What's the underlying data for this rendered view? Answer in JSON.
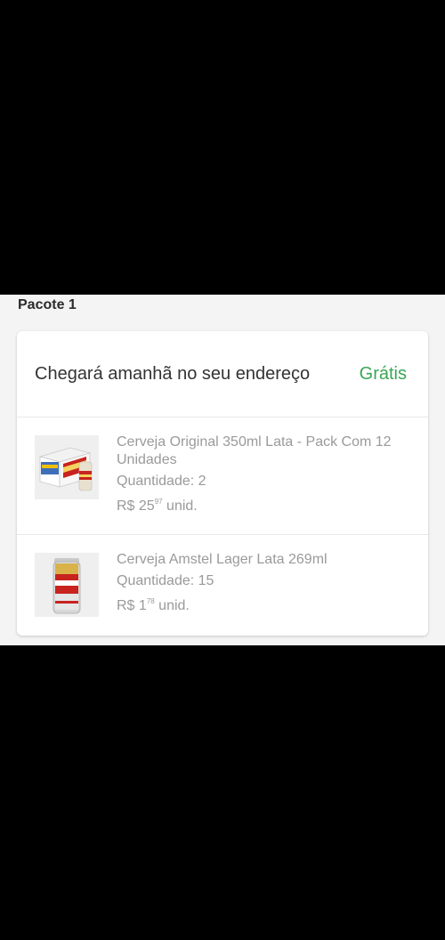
{
  "package": {
    "title": "Pacote 1"
  },
  "delivery": {
    "text": "Chegará amanhã no seu endereço",
    "shipping": "Grátis"
  },
  "items": [
    {
      "name": "Cerveja Original 350ml Lata - Pack Com 12 Unidades",
      "quantity": "Quantidade: 2",
      "currency": "R$ ",
      "price_int": "25",
      "price_cents": "97",
      "unit": " unid."
    },
    {
      "name": "Cerveja Amstel Lager Lata 269ml",
      "quantity": "Quantidade: 15",
      "currency": "R$ ",
      "price_int": "1",
      "price_cents": "78",
      "unit": " unid."
    }
  ]
}
